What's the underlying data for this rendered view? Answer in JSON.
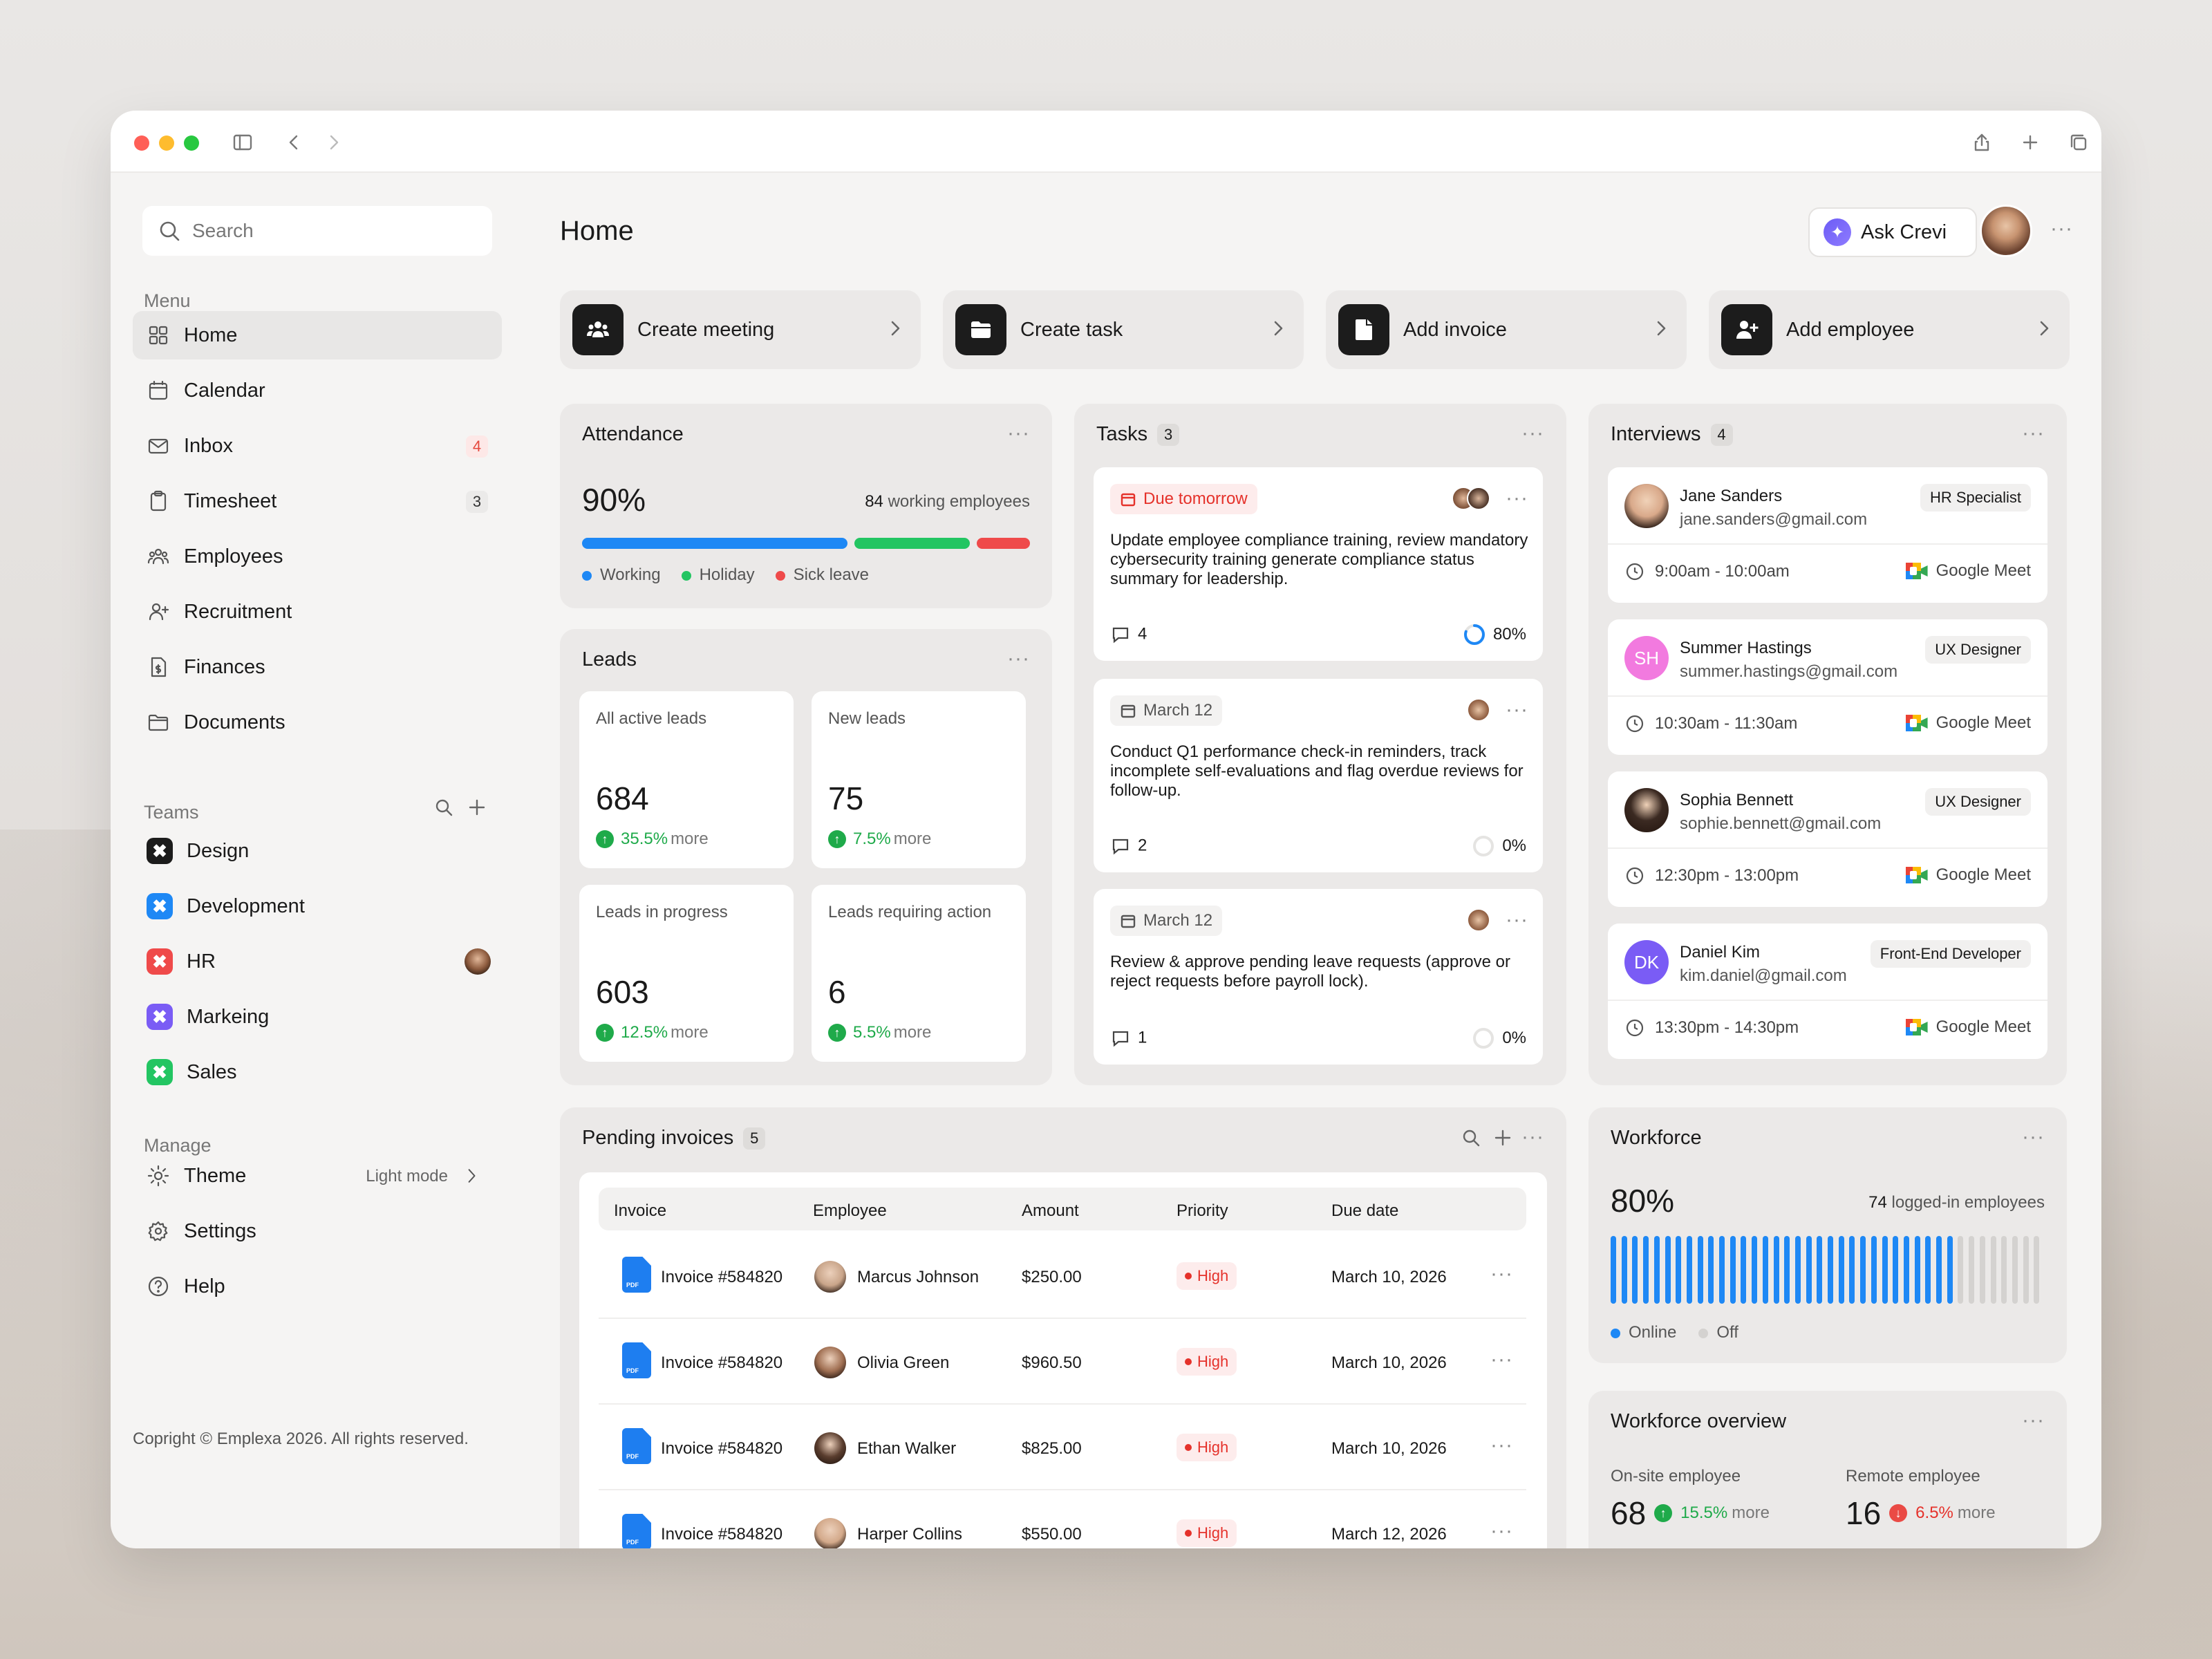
{
  "sidebar": {
    "search_placeholder": "Search",
    "menu_label": "Menu",
    "menu": [
      {
        "label": "Home",
        "icon": "grid-icon"
      },
      {
        "label": "Calendar",
        "icon": "calendar-icon"
      },
      {
        "label": "Inbox",
        "icon": "mail-icon",
        "badge": "4"
      },
      {
        "label": "Timesheet",
        "icon": "clipboard-icon",
        "badge": "3"
      },
      {
        "label": "Employees",
        "icon": "users-icon"
      },
      {
        "label": "Recruitment",
        "icon": "user-plus-icon"
      },
      {
        "label": "Finances",
        "icon": "invoice-icon"
      },
      {
        "label": "Documents",
        "icon": "folder-icon"
      }
    ],
    "teams_label": "Teams",
    "teams": [
      {
        "label": "Design",
        "color": "#1c1c1c"
      },
      {
        "label": "Development",
        "color": "#1e88f5"
      },
      {
        "label": "HR",
        "color": "#ef4a4a"
      },
      {
        "label": "Markeing",
        "color": "#7a5cf5"
      },
      {
        "label": "Sales",
        "color": "#23c562"
      }
    ],
    "manage_label": "Manage",
    "manage": [
      {
        "label": "Theme",
        "value": "Light mode",
        "icon": "sun-icon"
      },
      {
        "label": "Settings",
        "icon": "gear-icon"
      },
      {
        "label": "Help",
        "icon": "help-icon"
      }
    ],
    "copyright": "Copright © Emplexa 2026. All rights reserved."
  },
  "header": {
    "title": "Home",
    "ask_label": "Ask Crevi"
  },
  "quick_actions": [
    {
      "label": "Create meeting",
      "icon": "meeting-icon"
    },
    {
      "label": "Create task",
      "icon": "folder-icon"
    },
    {
      "label": "Add invoice",
      "icon": "document-icon"
    },
    {
      "label": "Add employee",
      "icon": "add-user-icon"
    }
  ],
  "attendance": {
    "title": "Attendance",
    "percent": "90%",
    "employees_count": "84",
    "employees_label": "working employees",
    "segments": [
      {
        "label": "Working",
        "value": 0.6,
        "color": "#1e88f5"
      },
      {
        "label": "Holiday",
        "value": 0.26,
        "color": "#23c562"
      },
      {
        "label": "Sick leave",
        "value": 0.12,
        "color": "#ef4a4a"
      }
    ]
  },
  "leads": {
    "title": "Leads",
    "items": [
      {
        "label": "All active leads",
        "value": "684",
        "delta": "35.5%",
        "more": "more"
      },
      {
        "label": "New leads",
        "value": "75",
        "delta": "7.5%",
        "more": "more"
      },
      {
        "label": "Leads in progress",
        "value": "603",
        "delta": "12.5%",
        "more": "more"
      },
      {
        "label": "Leads requiring action",
        "value": "6",
        "delta": "5.5%",
        "more": "more"
      }
    ]
  },
  "tasks": {
    "title": "Tasks",
    "count": "3",
    "items": [
      {
        "tag": "Due tomorrow",
        "urgent": true,
        "text": "Update employee compliance training, review mandatory cybersecurity training generate compliance status summary for leadership.",
        "comments": "4",
        "progress": "80%",
        "progress_value": 0.8
      },
      {
        "tag": "March 12",
        "urgent": false,
        "text": "Conduct Q1 performance check-in reminders, track incomplete self-evaluations and flag overdue reviews for follow-up.",
        "comments": "2",
        "progress": "0%",
        "progress_value": 0
      },
      {
        "tag": "March 12",
        "urgent": false,
        "text": "Review & approve pending leave requests (approve or reject requests before payroll lock).",
        "comments": "1",
        "progress": "0%",
        "progress_value": 0
      }
    ]
  },
  "interviews": {
    "title": "Interviews",
    "count": "4",
    "items": [
      {
        "name": "Jane Sanders",
        "email": "jane.sanders@gmail.com",
        "role": "HR Specialist",
        "time": "9:00am - 10:00am",
        "platform": "Google Meet",
        "initials": "",
        "color": "#d9a98a"
      },
      {
        "name": "Summer Hastings",
        "email": "summer.hastings@gmail.com",
        "role": "UX Designer",
        "time": "10:30am - 11:30am",
        "platform": "Google Meet",
        "initials": "SH",
        "color": "#f27adf"
      },
      {
        "name": "Sophia Bennett",
        "email": "sophie.bennett@gmail.com",
        "role": "UX Designer",
        "time": "12:30pm - 13:00pm",
        "platform": "Google Meet",
        "initials": "",
        "color": "#3b2a22"
      },
      {
        "name": "Daniel Kim",
        "email": "kim.daniel@gmail.com",
        "role": "Front-End Developer",
        "time": "13:30pm - 14:30pm",
        "platform": "Google Meet",
        "initials": "DK",
        "color": "#7a5cf5"
      }
    ]
  },
  "invoices": {
    "title": "Pending invoices",
    "count": "5",
    "columns": [
      "Invoice",
      "Employee",
      "Amount",
      "Priority",
      "Due date"
    ],
    "rows": [
      {
        "invoice": "Invoice #584820",
        "employee": "Marcus Johnson",
        "amount": "$250.00",
        "priority": "High",
        "due": "March 10, 2026"
      },
      {
        "invoice": "Invoice #584820",
        "employee": "Olivia Green",
        "amount": "$960.50",
        "priority": "High",
        "due": "March 10, 2026"
      },
      {
        "invoice": "Invoice #584820",
        "employee": "Ethan Walker",
        "amount": "$825.00",
        "priority": "High",
        "due": "March 10, 2026"
      },
      {
        "invoice": "Invoice #584820",
        "employee": "Harper Collins",
        "amount": "$550.00",
        "priority": "High",
        "due": "March 12, 2026"
      }
    ]
  },
  "workforce": {
    "title": "Workforce",
    "percent": "80%",
    "count": "74",
    "count_label": "logged-in employees",
    "online_label": "Online",
    "off_label": "Off",
    "total_bars": 40,
    "online_bars": 32,
    "online_color": "#1e88f5",
    "off_color": "#d4d2d0"
  },
  "workforce_overview": {
    "title": "Workforce overview",
    "items": [
      {
        "label": "On-site employee",
        "value": "68",
        "delta": "15.5%",
        "more": "more",
        "trend": "up"
      },
      {
        "label": "Remote employee",
        "value": "16",
        "delta": "6.5%",
        "more": "more",
        "trend": "down"
      }
    ]
  }
}
